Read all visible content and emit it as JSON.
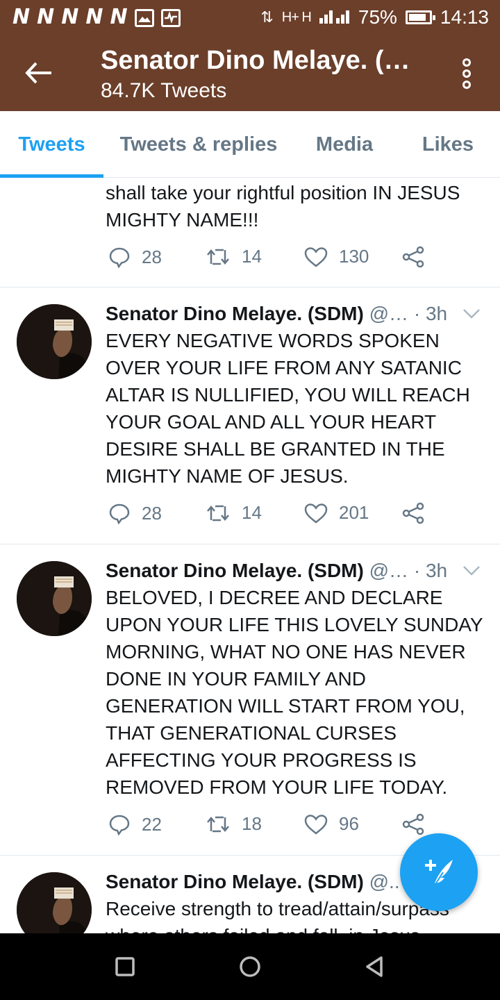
{
  "status_bar": {
    "notification_icons": [
      "N",
      "N",
      "N",
      "N",
      "N"
    ],
    "extra_icons": [
      "image-icon",
      "activity-icon"
    ],
    "network": "H+ H",
    "battery": "75%",
    "battery_level": 0.75,
    "time": "14:13"
  },
  "header": {
    "title": "Senator Dino Melaye. (S…",
    "subtitle": "84.7K Tweets",
    "background": "#6b3f2a"
  },
  "tabs": [
    {
      "label": "Tweets",
      "active": true
    },
    {
      "label": "Tweets & replies",
      "active": false
    },
    {
      "label": "Media",
      "active": false
    },
    {
      "label": "Likes",
      "active": false
    }
  ],
  "accent_color": "#1da1f2",
  "tweets": [
    {
      "text": "shall take your rightful position IN JESUS MIGHTY NAME!!!",
      "replies": "28",
      "retweets": "14",
      "likes": "130"
    },
    {
      "name": "Senator Dino Melaye. (SDM)",
      "handle": "@…",
      "time": "· 3h",
      "text": "EVERY NEGATIVE WORDS SPOKEN OVER YOUR LIFE FROM ANY SATANIC ALTAR IS NULLIFIED, YOU WILL REACH YOUR GOAL AND ALL YOUR HEART DESIRE SHALL BE GRANTED IN THE MIGHTY NAME OF JESUS.",
      "replies": "28",
      "retweets": "14",
      "likes": "201"
    },
    {
      "name": "Senator Dino Melaye. (SDM)",
      "handle": "@…",
      "time": "· 3h",
      "text": "BELOVED, I DECREE AND DECLARE UPON YOUR LIFE THIS LOVELY SUNDAY MORNING,  WHAT NO ONE HAS NEVER DONE IN YOUR FAMILY AND GENERATION WILL START FROM YOU, THAT GENERATIONAL CURSES AFFECTING YOUR PROGRESS IS REMOVED FROM YOUR LIFE TODAY.",
      "replies": "22",
      "retweets": "18",
      "likes": "96"
    },
    {
      "name": "Senator Dino Melaye. (SDM)",
      "handle": "@..",
      "text": "Receive strength to tread/attain/surpass where others failed and fell, in Jesus"
    }
  ],
  "icons": {
    "back": "arrow-left-icon",
    "more": "more-vertical-icon",
    "reply": "reply-icon",
    "retweet": "retweet-icon",
    "like": "heart-icon",
    "share": "share-icon",
    "compose": "compose-tweet-icon",
    "nav": [
      "recents-square-icon",
      "home-circle-icon",
      "back-triangle-icon"
    ]
  }
}
